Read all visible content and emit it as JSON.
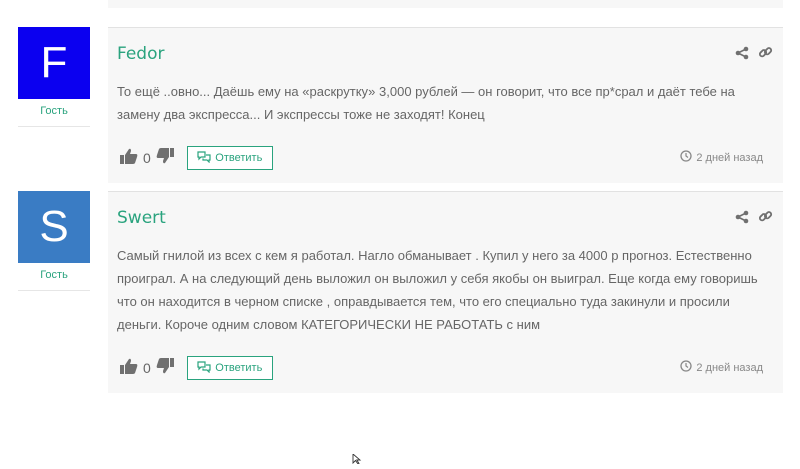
{
  "comments": [
    {
      "avatar_letter": "F",
      "avatar_color": "#0b00f0",
      "role": "Гость",
      "author": "Fedor",
      "text": "То ещё ..овно... Даёшь ему на «раскрутку» 3,000 рублей — он говорит, что все пр*срал и даёт тебе на замену два экспресса... И экспрессы тоже не заходят! Конец",
      "votes": "0",
      "reply_label": "Ответить",
      "time": "2 дней назад"
    },
    {
      "avatar_letter": "S",
      "avatar_color": "#3a7cc4",
      "role": "Гость",
      "author": "Swert",
      "text": "Самый гнилой из всех с кем я работал. Нагло обманывает . Купил у него за 4000 р прогноз. Естественно проиграл. А на следующий день выложил он выложил у себя якобы он выиграл. Еще когда ему говоришь что он находится в черном списке , оправдывается тем, что его специально туда закинули и просили деньги. Короче одним словом КАТЕГОРИЧЕСКИ НЕ РАБОТАТЬ с ним",
      "votes": "0",
      "reply_label": "Ответить",
      "time": "2 дней назад"
    }
  ],
  "colors": {
    "accent": "#2aa37e",
    "body_bg": "#f7f7f7",
    "icon_gray": "#707070"
  },
  "icons": {
    "share": "share-icon",
    "link": "link-icon",
    "like": "thumbs-up-icon",
    "dislike": "thumbs-down-icon",
    "reply": "chat-bubbles-icon",
    "time": "clock-icon"
  }
}
